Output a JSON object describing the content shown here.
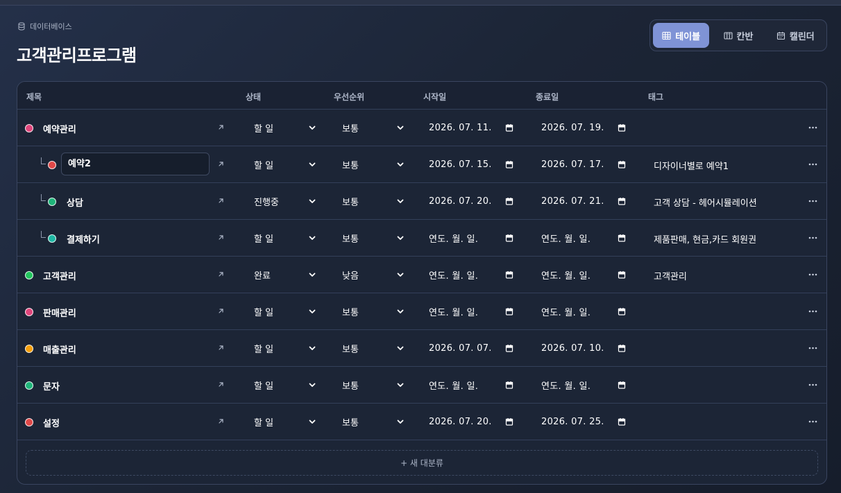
{
  "breadcrumb": "데이터베이스",
  "page_title": "고객관리프로그램",
  "views": [
    {
      "label": "테이블",
      "icon": "table-icon",
      "active": true
    },
    {
      "label": "칸반",
      "icon": "kanban-icon",
      "active": false
    },
    {
      "label": "캘린더",
      "icon": "calendar-icon",
      "active": false
    }
  ],
  "columns": {
    "title": "제목",
    "status": "상태",
    "priority": "우선순위",
    "start": "시작일",
    "end": "종료일",
    "tags": "태그"
  },
  "rows": [
    {
      "title": "예약관리",
      "level": 0,
      "color": "#e0457b",
      "status": "할 일",
      "priority": "보통",
      "start": "2026. 07. 11.",
      "end": "2026. 07. 19.",
      "tags": ""
    },
    {
      "title": "예약2",
      "level": 1,
      "color": "#e04848",
      "editing": true,
      "status": "할 일",
      "priority": "보통",
      "start": "2026. 07. 15.",
      "end": "2026. 07. 17.",
      "tags": "디자이너별로 예약1"
    },
    {
      "title": "상담",
      "level": 1,
      "color": "#1fb57a",
      "status": "진행중",
      "priority": "보통",
      "start": "2026. 07. 20.",
      "end": "2026. 07. 21.",
      "tags": "고객 상담 - 헤어시뮬레이션"
    },
    {
      "title": "결제하기",
      "level": 1,
      "color": "#1fb8a4",
      "status": "할 일",
      "priority": "보통",
      "start": "연도. 월. 일.",
      "end": "연도. 월. 일.",
      "tags": "제품판매, 현금,카드 회원권"
    },
    {
      "title": "고객관리",
      "level": 0,
      "color": "#22c55e",
      "status": "완료",
      "priority": "낮음",
      "start": "연도. 월. 일.",
      "end": "연도. 월. 일.",
      "tags": "고객관리"
    },
    {
      "title": "판매관리",
      "level": 0,
      "color": "#e0457b",
      "status": "할 일",
      "priority": "보통",
      "start": "연도. 월. 일.",
      "end": "연도. 월. 일.",
      "tags": ""
    },
    {
      "title": "매출관리",
      "level": 0,
      "color": "#f59e0b",
      "status": "할 일",
      "priority": "보통",
      "start": "2026. 07. 07.",
      "end": "2026. 07. 10.",
      "tags": ""
    },
    {
      "title": "문자",
      "level": 0,
      "color": "#1fb57a",
      "status": "할 일",
      "priority": "보통",
      "start": "연도. 월. 일.",
      "end": "연도. 월. 일.",
      "tags": ""
    },
    {
      "title": "설정",
      "level": 0,
      "color": "#e04848",
      "status": "할 일",
      "priority": "보통",
      "start": "2026. 07. 20.",
      "end": "2026. 07. 25.",
      "tags": ""
    }
  ],
  "add_label": "+ 새 대분류"
}
